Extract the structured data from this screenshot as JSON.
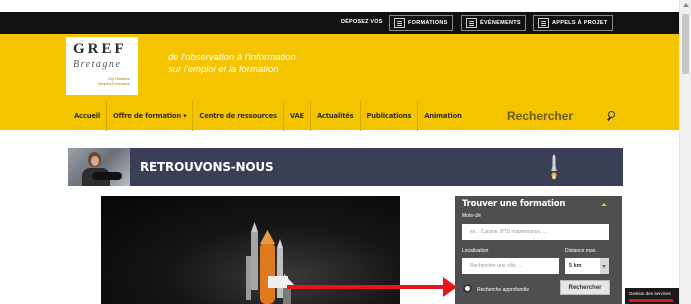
{
  "topbar": {
    "depose_label": "DÉPOSEZ VOS",
    "buttons": [
      {
        "label": "FORMATIONS",
        "icon": "formations-icon"
      },
      {
        "label": "ÉVÉNEMENTS",
        "icon": "evenements-icon"
      },
      {
        "label": "APPELS À PROJET",
        "icon": "appels-projet-icon"
      }
    ]
  },
  "logo": {
    "name": "GREF",
    "subname": "Bretagne",
    "gip_line1": "Gip Relation",
    "gip_line2": "Emploi-Formation"
  },
  "tagline": {
    "line1": "de l'observation à l'information",
    "line2": "sur l'emploi et la formation"
  },
  "nav": {
    "items": [
      "Accueil",
      "Offre de formation ▾",
      "Centre de ressources",
      "VAE",
      "Actualités",
      "Publications",
      "Animation"
    ],
    "search_label": "Rechercher"
  },
  "banner": {
    "title": "RETROUVONS-NOUS"
  },
  "find_formation": {
    "title": "Trouver une formation",
    "keywords_label": "Mots-clé",
    "keywords_placeholder": "ex. : Cuisine, BTS maintenance, ...",
    "location_label": "Localisation",
    "location_placeholder": "Rechercher une ville, ...",
    "distance_label": "Distance max.",
    "distance_value": "5 km",
    "advanced_label": "Recherche approfondie",
    "submit_label": "Rechercher"
  },
  "cookie": {
    "label": "Gestion des services"
  },
  "colors": {
    "header_yellow": "#f5c400",
    "banner_bg": "#3a3f56",
    "panel_bg": "#4f4f4f",
    "arrow_red": "#e8141b"
  }
}
